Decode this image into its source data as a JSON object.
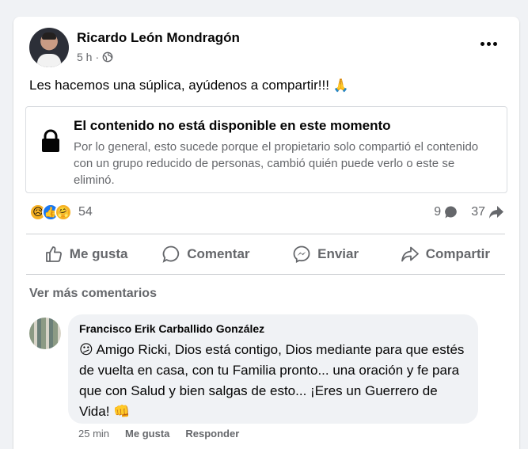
{
  "post": {
    "author": "Ricardo León Mondragón",
    "time": "5 h",
    "separator": "·",
    "text": "Les hacemos una súplica, ayúdenos a compartir!!!",
    "emoji": "🙏"
  },
  "unavailable": {
    "title": "El contenido no está disponible en este momento",
    "body": "Por lo general, esto sucede porque el propietario solo compartió el contenido con un grupo reducido de personas, cambió quién puede verlo o este se eliminó."
  },
  "stats": {
    "reaction_count": "54",
    "comments": "9",
    "shares": "37"
  },
  "actions": {
    "like": "Me gusta",
    "comment": "Comentar",
    "send": "Enviar",
    "share": "Compartir"
  },
  "more_comments": "Ver más comentarios",
  "comment": {
    "author": "Francisco Erik Carballido González",
    "text": "😕 Amigo Ricki, Dios está contigo, Dios mediante para que estés de vuelta en casa, con tu Familia pronto... una oración y fe para que con Salud y bien salgas de esto... ¡Eres un Guerrero de Vida! 👊",
    "time": "25 min",
    "like": "Me gusta",
    "reply": "Responder"
  },
  "icons": {
    "reaction_sad": "😥",
    "reaction_like": "👍",
    "reaction_care": "🤗"
  },
  "colors": {
    "like_blue": "#1877f2",
    "secondary_text": "#65676b",
    "bubble_bg": "#f0f2f5"
  }
}
